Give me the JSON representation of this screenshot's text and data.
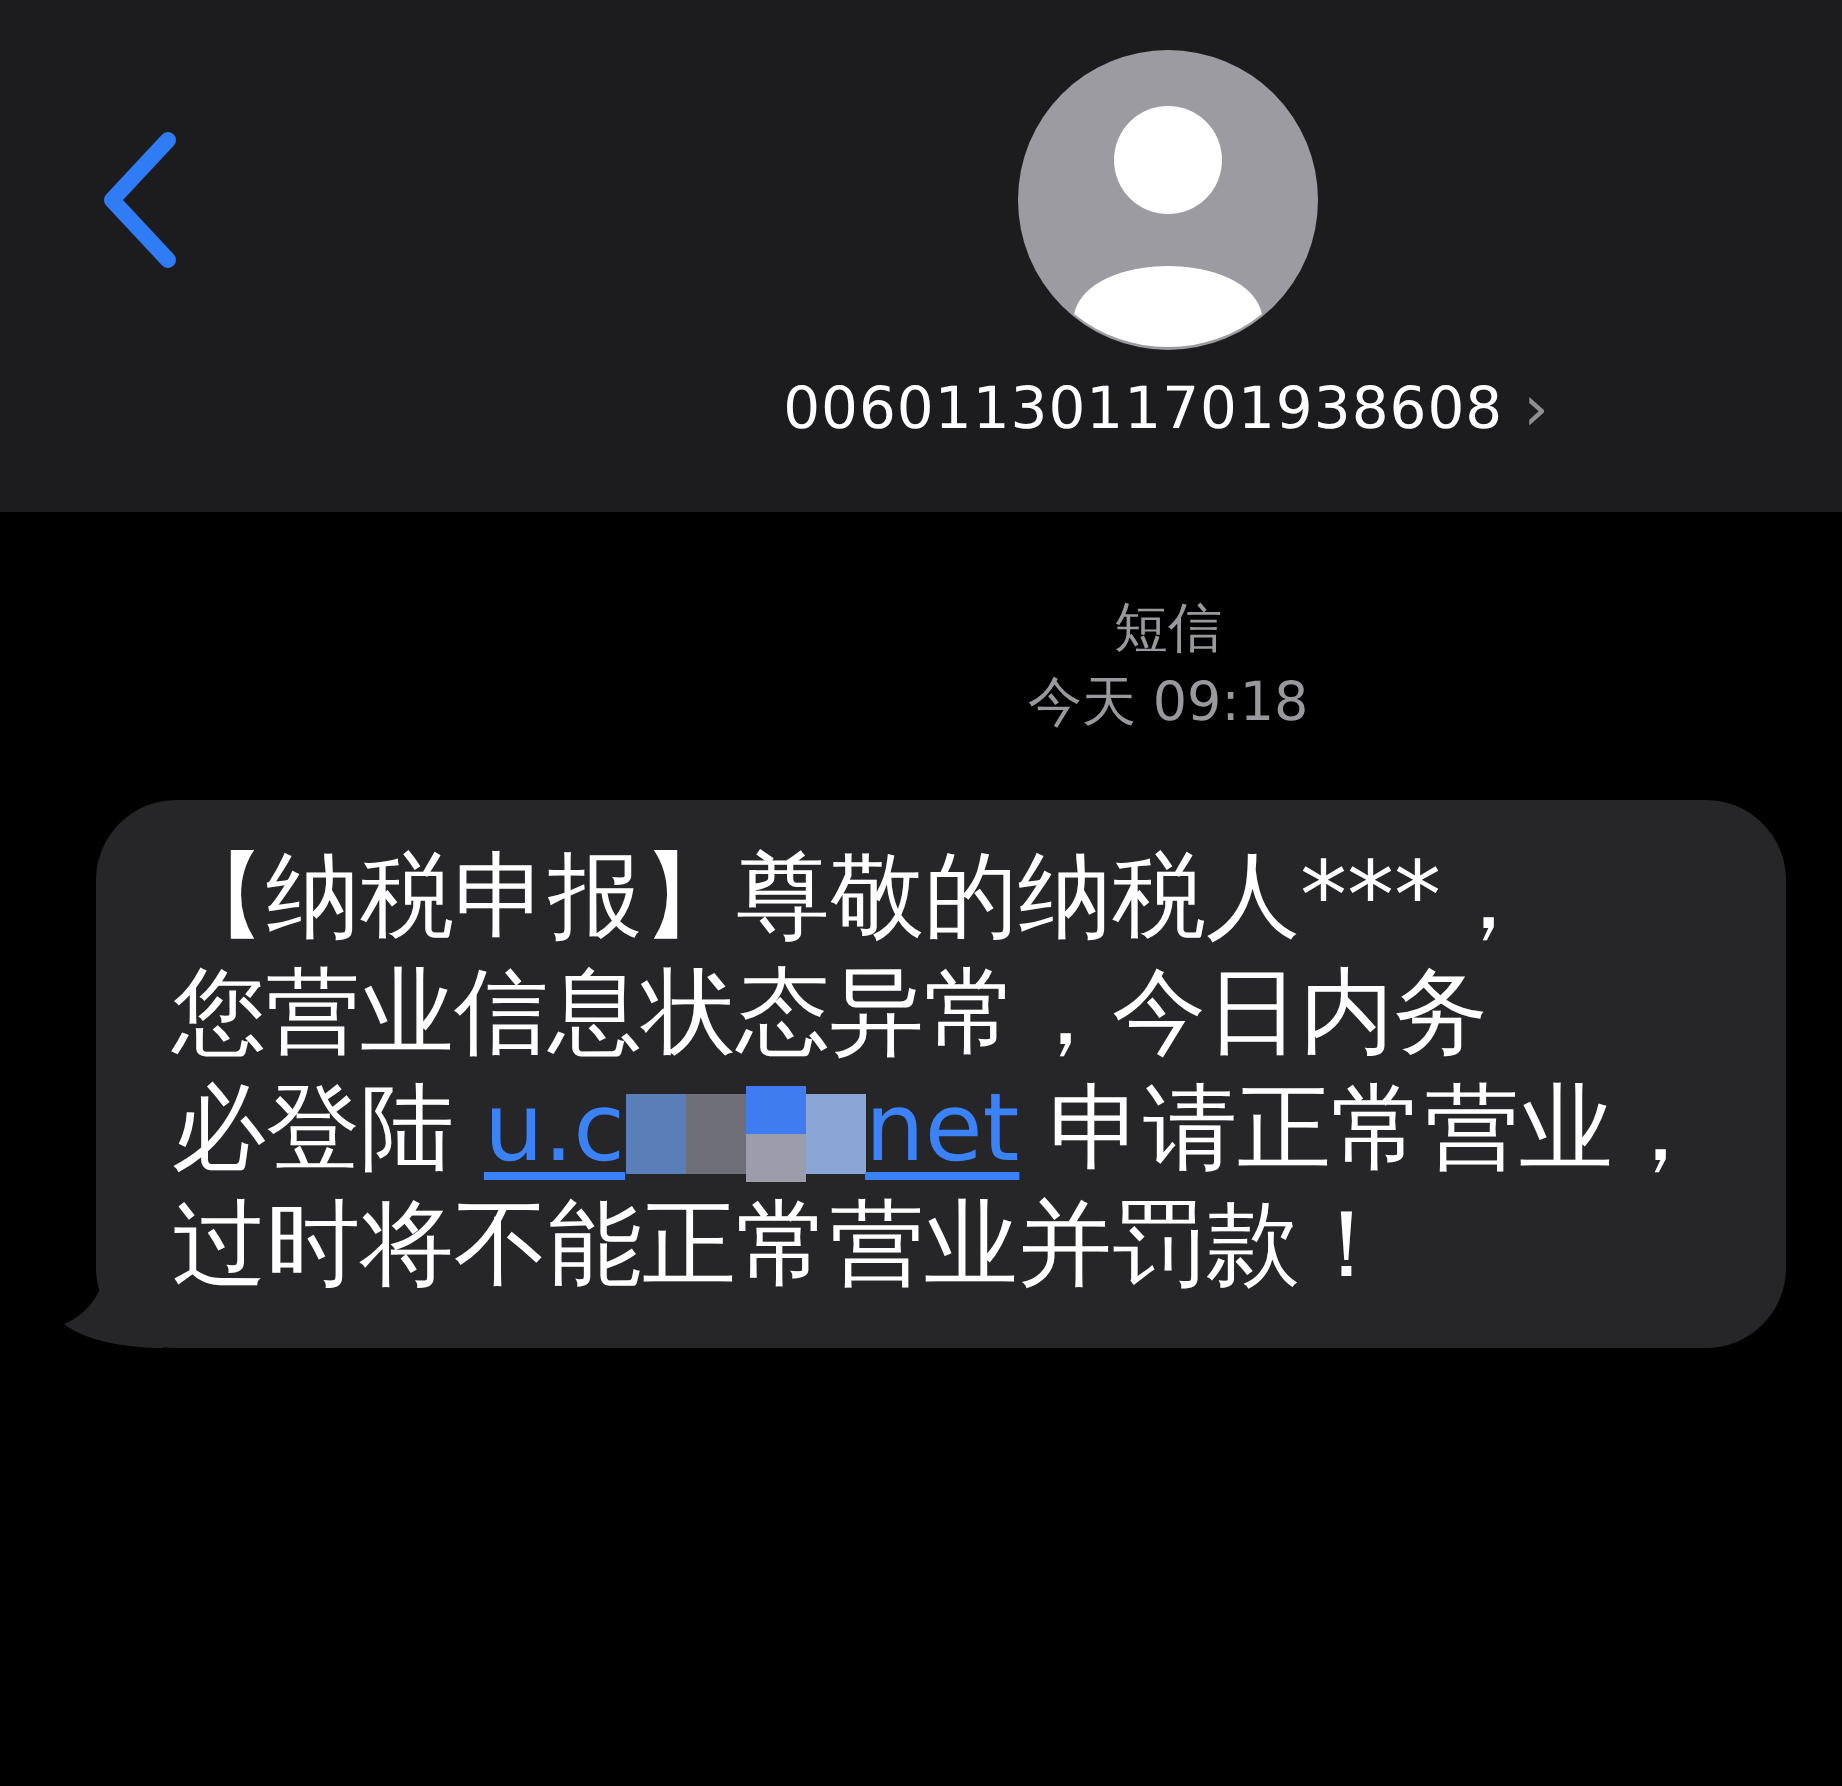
{
  "header": {
    "contact": "0060113011701938608",
    "chevron": "›"
  },
  "thread": {
    "service": "短信",
    "timestamp": "今天 09:18",
    "message": [
      {
        "kind": "text",
        "text": "【纳税申报】尊敬的纳税人***，"
      },
      {
        "kind": "break"
      },
      {
        "kind": "text",
        "text": "您营业信息状态异常，今日内务"
      },
      {
        "kind": "break"
      },
      {
        "kind": "text",
        "text": "必登陆 "
      },
      {
        "kind": "link",
        "start": "u.c",
        "end": "net"
      },
      {
        "kind": "text",
        "text": " 申请正常营业，"
      },
      {
        "kind": "break"
      },
      {
        "kind": "text",
        "text": "过时将不能正常营业并罚款！"
      }
    ]
  }
}
